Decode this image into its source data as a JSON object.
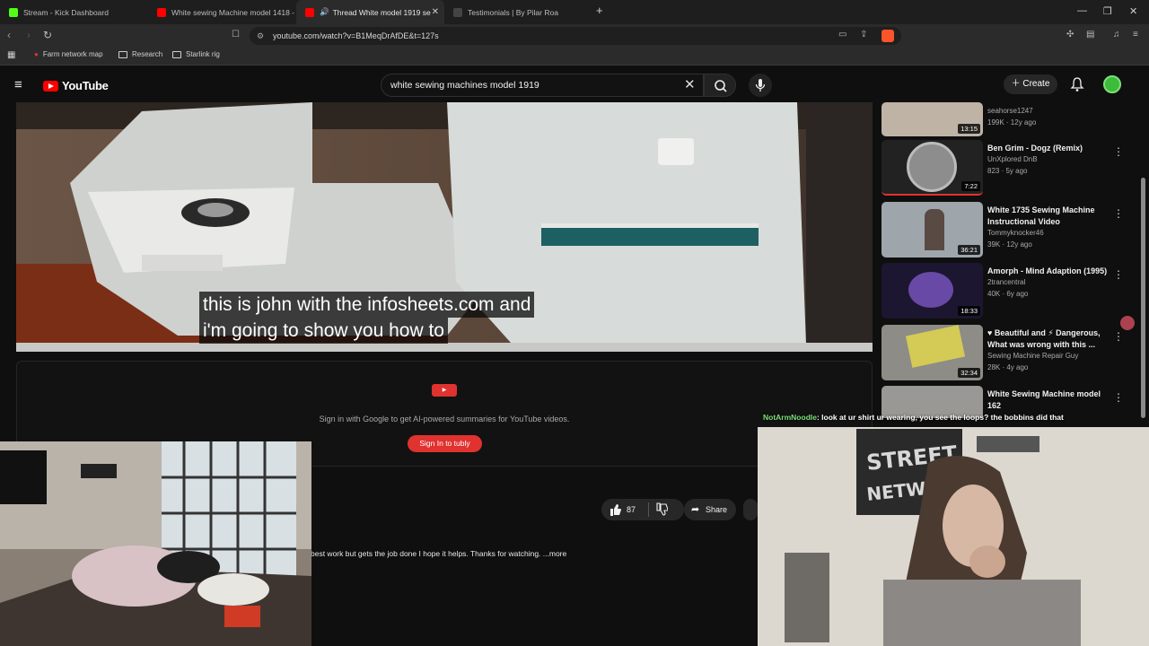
{
  "browser": {
    "tabs": [
      {
        "label": "Stream - Kick Dashboard",
        "color": "#53fc18"
      },
      {
        "label": "White sewing Machine model 1418 -",
        "color": "#ff0000"
      },
      {
        "label": "Thread White model 1919 se",
        "color": "#ff0000"
      },
      {
        "label": "Testimonials | By Pilar Roa",
        "color": "#444444"
      }
    ],
    "url": "youtube.com/watch?v=B1MeqDrAfDE&t=127s",
    "bookmarks": [
      "Farm network map",
      "Research",
      "Starlink rig"
    ]
  },
  "youtube": {
    "logo_text": "YouTube",
    "search_value": "white sewing machines model 1919",
    "create_label": "Create"
  },
  "video": {
    "subtitle_line1": "this is john with the infosheets.com and",
    "subtitle_line2": "i'm going to show you how to"
  },
  "tubly": {
    "badge": "▶",
    "text": "Sign in with Google to get AI-powered summaries for YouTube videos.",
    "button": "Sign In to tubly"
  },
  "actions": {
    "likes": "87",
    "share": "Share"
  },
  "description": "best work but gets the job done I hope it helps.  Thanks for watching.  ...more",
  "recommendations": [
    {
      "title": "",
      "channel": "seahorse1247",
      "meta": "199K · 12y ago",
      "duration": "13:15"
    },
    {
      "title": "Ben Grim - Dogz (Remix)",
      "channel": "UnXplored DnB",
      "meta": "823 · 5y ago",
      "duration": "7:22"
    },
    {
      "title": "White 1735 Sewing Machine Instructional Video",
      "channel": "Tommyknocker46",
      "meta": "39K · 12y ago",
      "duration": "36:21"
    },
    {
      "title": "Amorph - Mind Adaption (1995)",
      "channel": "2trancentral",
      "meta": "40K · 6y ago",
      "duration": "18:33"
    },
    {
      "title": "♥ Beautiful and ⚡ Dangerous, What was wrong with this ...",
      "channel": "Sewing Machine Repair Guy",
      "meta": "28K · 4y ago",
      "duration": "32:34"
    },
    {
      "title": "White Sewing Machine model 162",
      "channel": "",
      "meta": "",
      "duration": ""
    }
  ],
  "chat": {
    "user": "NotArmNoodle",
    "message": ": look at ur shirt ur wearing, you see the loops? the bobbins did that"
  }
}
